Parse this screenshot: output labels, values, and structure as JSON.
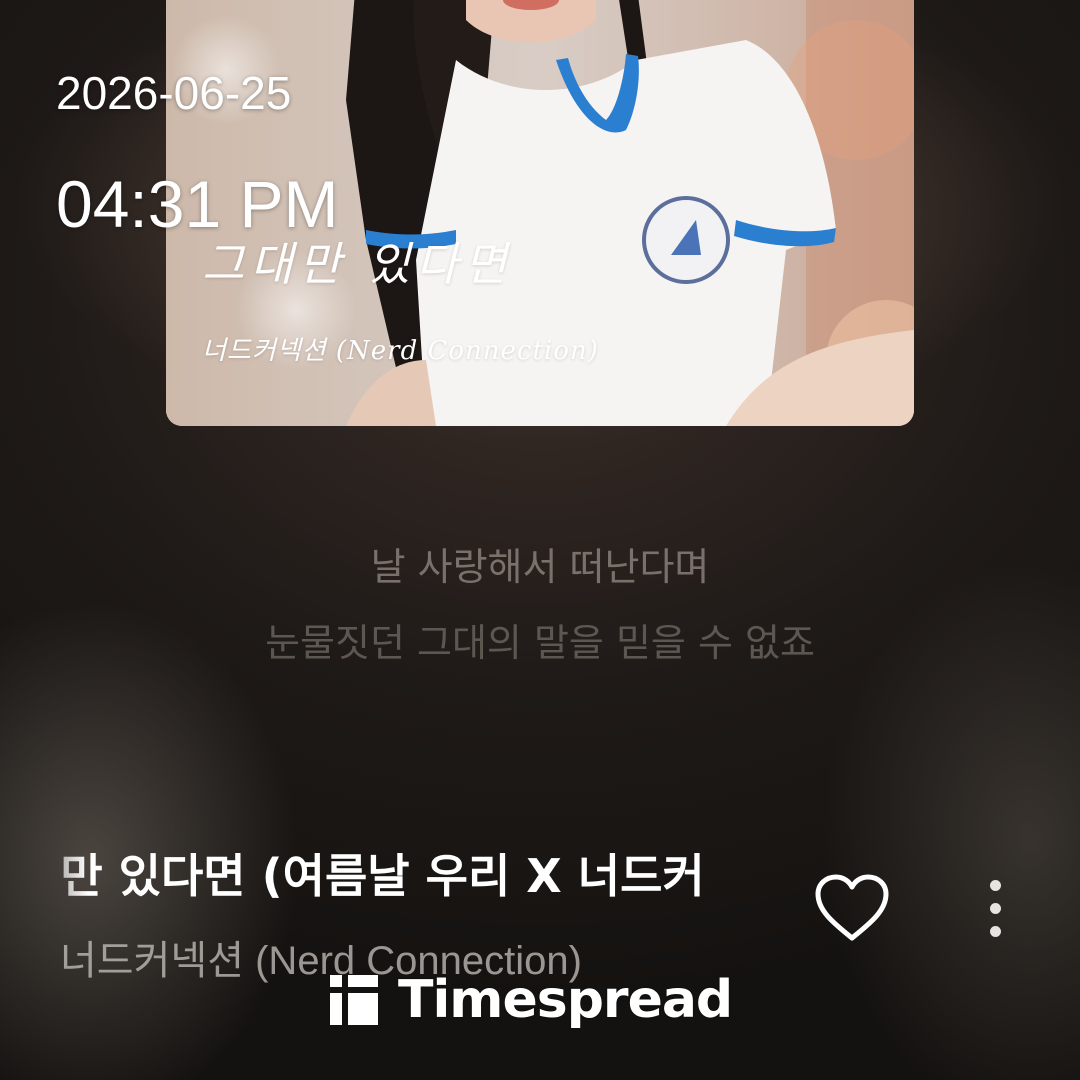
{
  "clock": {
    "date": "2026-06-25",
    "time": "04:31 PM"
  },
  "album_art": {
    "title": "그대만 있다면",
    "artist": "너드커넥션 (Nerd Connection)"
  },
  "lyrics": [
    "날 사랑해서 떠난다며",
    "눈물짓던 그대의 말을 믿을 수 없죠"
  ],
  "now_playing": {
    "title": "대만 있다면 (여름날 우리 X 너드커",
    "artist": "너드커넥션 (Nerd Connection)"
  },
  "icons": {
    "like": "heart-outline-icon",
    "more": "more-vertical-icon",
    "watermark_logo": "timespread-logo-icon"
  },
  "watermark": {
    "text": "Timespread"
  },
  "colors": {
    "background": "#1f1a18",
    "text_primary": "#ffffff",
    "lyric_dim": "#968c86"
  }
}
